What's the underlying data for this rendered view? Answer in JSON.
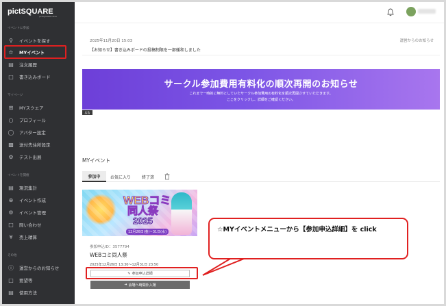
{
  "app": {
    "logo": "pictSQUARE",
    "logo_sub": "pictSQUARE.online"
  },
  "sidebar": {
    "section_event": "イベントに参加",
    "section_mypage": "マイページ",
    "section_host": "イベントを開催",
    "section_other": "その他",
    "items": [
      {
        "label": "イベントを探す",
        "icon": "search-icon"
      },
      {
        "label": "MYイベント",
        "icon": "star-icon"
      },
      {
        "label": "注文履歴",
        "icon": "receipt-icon"
      },
      {
        "label": "書き込みボード",
        "icon": "board-icon"
      },
      {
        "label": "MYスクエア",
        "icon": "grid-icon"
      },
      {
        "label": "プロフィール",
        "icon": "user-icon"
      },
      {
        "label": "アバター設定",
        "icon": "avatar-icon"
      },
      {
        "label": "送付先住所設定",
        "icon": "truck-icon"
      },
      {
        "label": "テスト出展",
        "icon": "test-icon"
      },
      {
        "label": "現況集計",
        "icon": "chart-icon"
      },
      {
        "label": "イベント作成",
        "icon": "plus-circle-icon"
      },
      {
        "label": "イベント管理",
        "icon": "gear-icon"
      },
      {
        "label": "問い合わせ",
        "icon": "chat-icon"
      },
      {
        "label": "売上精算",
        "icon": "yen-icon"
      },
      {
        "label": "運営からのお知らせ",
        "icon": "info-icon"
      },
      {
        "label": "要望等",
        "icon": "message-icon"
      },
      {
        "label": "使用方法",
        "icon": "book-icon"
      }
    ]
  },
  "topbar": {
    "bell_icon": "bell-icon",
    "avatar_icon": "avatar-icon"
  },
  "notice": {
    "date": "2025年11月20日 15:03",
    "source": "運営からのお知らせ",
    "text": "【お知らせ】書き込みボードの投稿制限を一部緩和しました"
  },
  "banner": {
    "title": "サークル参加費用有料化の順次再開のお知らせ",
    "line1": "これまで一時的に無料としていたサークル参加費用の有料化を順次再開させていただきます。",
    "line2": "ここをクリックし、詳細をご確認ください。",
    "badge": "広告"
  },
  "my_events": {
    "title": "MYイベント",
    "tabs": [
      "参加中",
      "お気に入り",
      "終了済"
    ],
    "trash_icon": "trash-icon"
  },
  "event_card": {
    "image_title1": "WEBコミ",
    "image_title2": "同人祭",
    "image_year": "2025",
    "image_dates": "12月26日(金)~31日(水)",
    "id_text": "参加申込ID：3577794",
    "name": "WEBコミ同人祭",
    "period": "2025年12月26日 13:30～12月31日 23:50",
    "detail_button": "参加申込詳細",
    "enter_button": "会場へ時間外入場"
  },
  "annotation": {
    "callout_text": "☆MYイベントメニューから【参加申込詳細】を click",
    "color": "#e02020"
  }
}
